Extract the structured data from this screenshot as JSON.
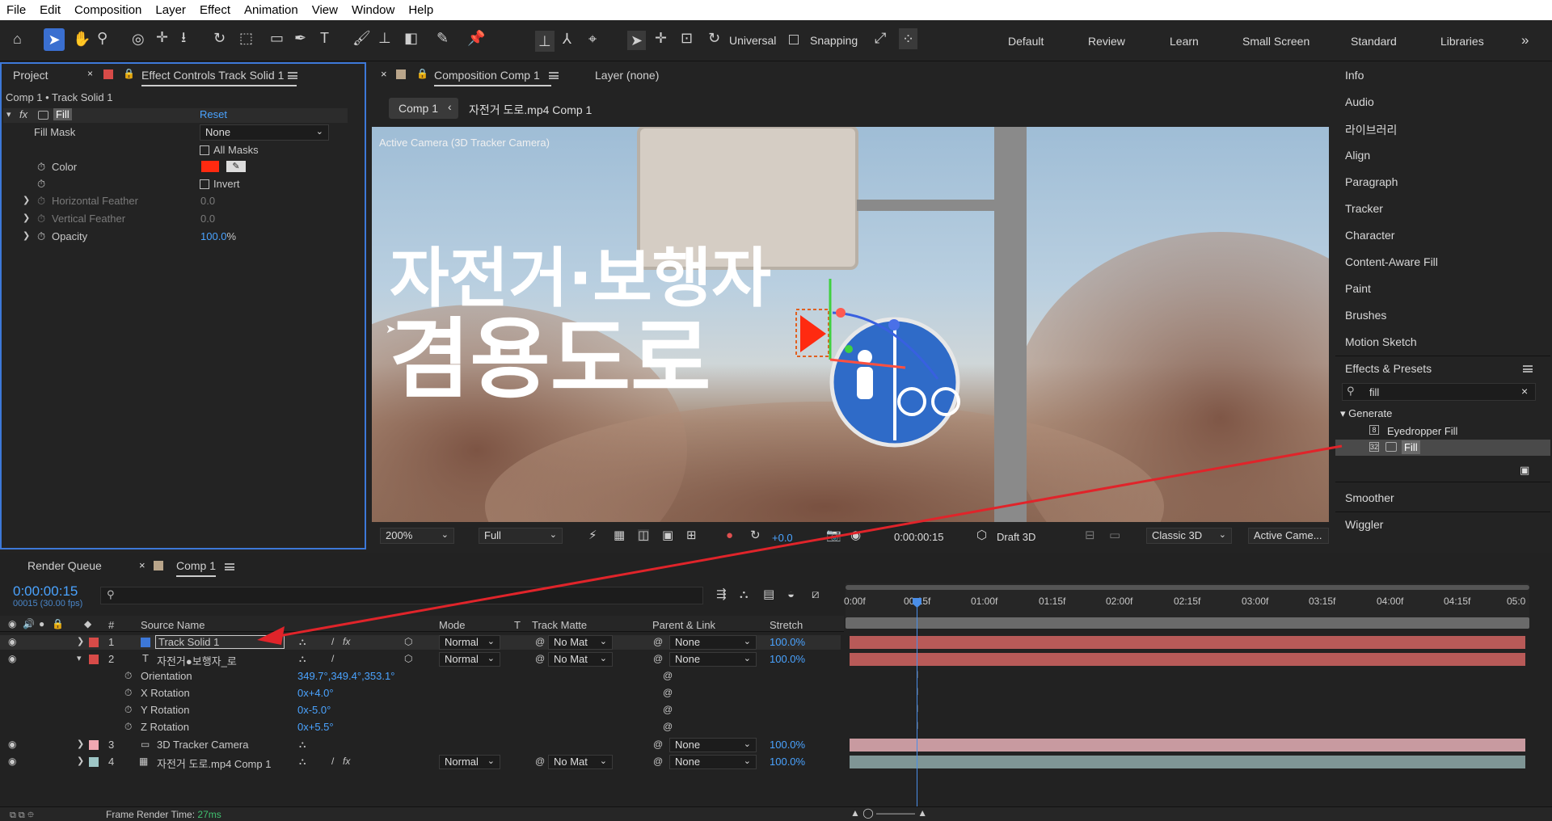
{
  "menu": [
    "File",
    "Edit",
    "Composition",
    "Layer",
    "Effect",
    "Animation",
    "View",
    "Window",
    "Help"
  ],
  "toolbar": {
    "universal_label": "Universal",
    "snapping_label": "Snapping"
  },
  "workspaces": [
    "Default",
    "Review",
    "Learn",
    "Small Screen",
    "Standard",
    "Libraries"
  ],
  "left_panel": {
    "tab_project": "Project",
    "tab_effect_controls": "Effect Controls Track Solid 1",
    "breadcrumb": "Comp 1 • Track Solid 1",
    "effect_name": "Fill",
    "reset_label": "Reset",
    "fx_label": "fx",
    "fill_mask_label": "Fill Mask",
    "fill_mask_value": "None",
    "all_masks_label": "All Masks",
    "color_label": "Color",
    "color_value": "#ff2a10",
    "invert_label": "Invert",
    "h_feather_label": "Horizontal Feather",
    "h_feather_value": "0.0",
    "v_feather_label": "Vertical Feather",
    "v_feather_value": "0.0",
    "opacity_label": "Opacity",
    "opacity_value": "100.0",
    "opacity_unit": "%"
  },
  "viewer": {
    "tab_comp": "Composition Comp 1",
    "tab_layer": "Layer (none)",
    "crumb_comp": "Comp 1",
    "crumb_child": "자전거 도로.mp4 Comp 1",
    "camera_label": "Active Camera (3D Tracker Camera)",
    "sign_line1": "자전거·보행자",
    "sign_line2": "겸용도로",
    "zoom": "200%",
    "resolution": "Full",
    "exposure": "+0.0",
    "timecode": "0:00:00:15",
    "draft": "Draft 3D",
    "renderer": "Classic 3D",
    "view": "Active Came..."
  },
  "right_panel": {
    "items": [
      "Info",
      "Audio",
      "라이브러리",
      "Align",
      "Paragraph",
      "Tracker",
      "Character",
      "Content-Aware Fill",
      "Paint",
      "Brushes",
      "Motion Sketch"
    ],
    "effects_title": "Effects & Presets",
    "search_value": "fill",
    "group": "Generate",
    "eff1": "Eyedropper Fill",
    "eff2": "Fill",
    "more": [
      "Smoother",
      "Wiggler"
    ]
  },
  "timeline": {
    "tab_render": "Render Queue",
    "tab_comp": "Comp 1",
    "timecode": "0:00:00:15",
    "frames": "00015 (30.00 fps)",
    "headers": {
      "num": "#",
      "source": "Source Name",
      "mode": "Mode",
      "t": "T",
      "matte": "Track Matte",
      "parent": "Parent & Link",
      "stretch": "Stretch"
    },
    "ruler": [
      "0:00f",
      "00:15f",
      "01:00f",
      "01:15f",
      "02:00f",
      "02:15f",
      "03:00f",
      "03:15f",
      "04:00f",
      "04:15f",
      "05:0"
    ],
    "layers": [
      {
        "num": "1",
        "name": "Track Solid 1",
        "mode": "Normal",
        "matte": "No Mat",
        "parent": "None",
        "stretch": "100.0%",
        "color": "#d74b48"
      },
      {
        "num": "2",
        "name": "자전거●보행자_로",
        "mode": "Normal",
        "matte": "No Mat",
        "parent": "None",
        "stretch": "100.0%",
        "color": "#d74b48"
      },
      {
        "num": "3",
        "name": "3D Tracker Camera",
        "parent": "None",
        "stretch": "100.0%",
        "color": "#f0a8b2"
      },
      {
        "num": "4",
        "name": "자전거 도로.mp4 Comp 1",
        "mode": "Normal",
        "matte": "No Mat",
        "parent": "None",
        "stretch": "100.0%",
        "color": "#9ec6c6"
      }
    ],
    "props": [
      {
        "label": "Orientation",
        "value": "349.7°,349.4°,353.1°"
      },
      {
        "label": "X Rotation",
        "value": "0x+4.0°"
      },
      {
        "label": "Y Rotation",
        "value": "0x-5.0°"
      },
      {
        "label": "Z Rotation",
        "value": "0x+5.5°"
      }
    ],
    "render_time_label": "Frame Render Time:",
    "render_time_value": "27ms"
  }
}
